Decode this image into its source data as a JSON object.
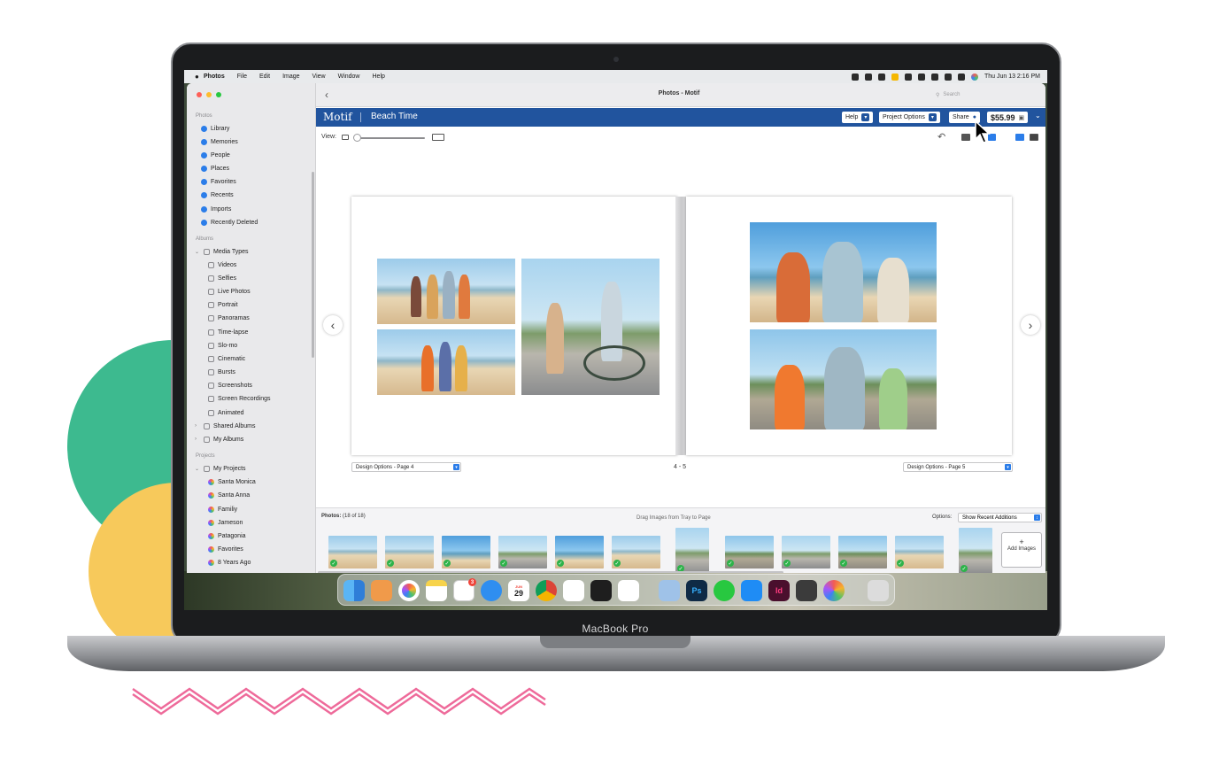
{
  "menubar": {
    "apple": "",
    "items": [
      "Photos",
      "File",
      "Edit",
      "Image",
      "View",
      "Window",
      "Help"
    ],
    "clock": "Thu Jun 13  2:16 PM"
  },
  "window": {
    "title": "Photos - Motif",
    "search_placeholder": "Search"
  },
  "sidebar": {
    "sections": {
      "photos": "Photos",
      "albums": "Albums",
      "projects": "Projects"
    },
    "photos_items": [
      "Library",
      "Memories",
      "People",
      "Places",
      "Favorites",
      "Recents",
      "Imports",
      "Recently Deleted"
    ],
    "media_types": "Media Types",
    "media_items": [
      "Videos",
      "Selfies",
      "Live Photos",
      "Portrait",
      "Panoramas",
      "Time-lapse",
      "Slo-mo",
      "Cinematic",
      "Bursts",
      "Screenshots",
      "Screen Recordings",
      "Animated"
    ],
    "shared_albums": "Shared Albums",
    "my_albums": "My Albums",
    "my_projects": "My Projects",
    "project_items": [
      "Santa Monica",
      "Santa Anna",
      "Familiy",
      "Jameson",
      "Patagonia",
      "Favorites",
      "8 Years Ago"
    ]
  },
  "motif": {
    "logo": "Motif",
    "project_name": "Beach Time",
    "help": "Help",
    "project_options": "Project Options",
    "share": "Share",
    "price": "$55.99"
  },
  "toolbar": {
    "view_label": "View:"
  },
  "book": {
    "left_design": "Design Options - Page 4",
    "right_design": "Design Options - Page 5",
    "page_range": "4 - 5"
  },
  "tray": {
    "count_label": "Photos:",
    "count": "(18 of 18)",
    "hint": "Drag Images from Tray to Page",
    "options_label": "Options:",
    "options_value": "Show Recent Additions",
    "add_images": "Add Images",
    "add_plus": "+"
  },
  "device": {
    "label": "MacBook Pro"
  },
  "dock": {
    "calendar_month": "JUN",
    "calendar_day": "29",
    "reminders_badge": "3",
    "apps": [
      "Finder",
      "Launchpad",
      "Photos",
      "Notes",
      "Reminders",
      "Safari",
      "Calendar",
      "Chrome",
      "Slack",
      "Figma",
      "VS Code",
      "Preview",
      "Photoshop",
      "WhatsApp",
      "App Store",
      "InDesign",
      "Sublime Text",
      "Motif",
      "Trash"
    ],
    "photoshop": "Ps",
    "indesign": "Id"
  },
  "colors": {
    "motif_blue": "#21549e",
    "accent_blue": "#2b7de9",
    "check_green": "#2db34a",
    "blob_green": "#3dba8f",
    "blob_yellow": "#f7c95b",
    "zigzag_pink": "#ee6a9a"
  }
}
